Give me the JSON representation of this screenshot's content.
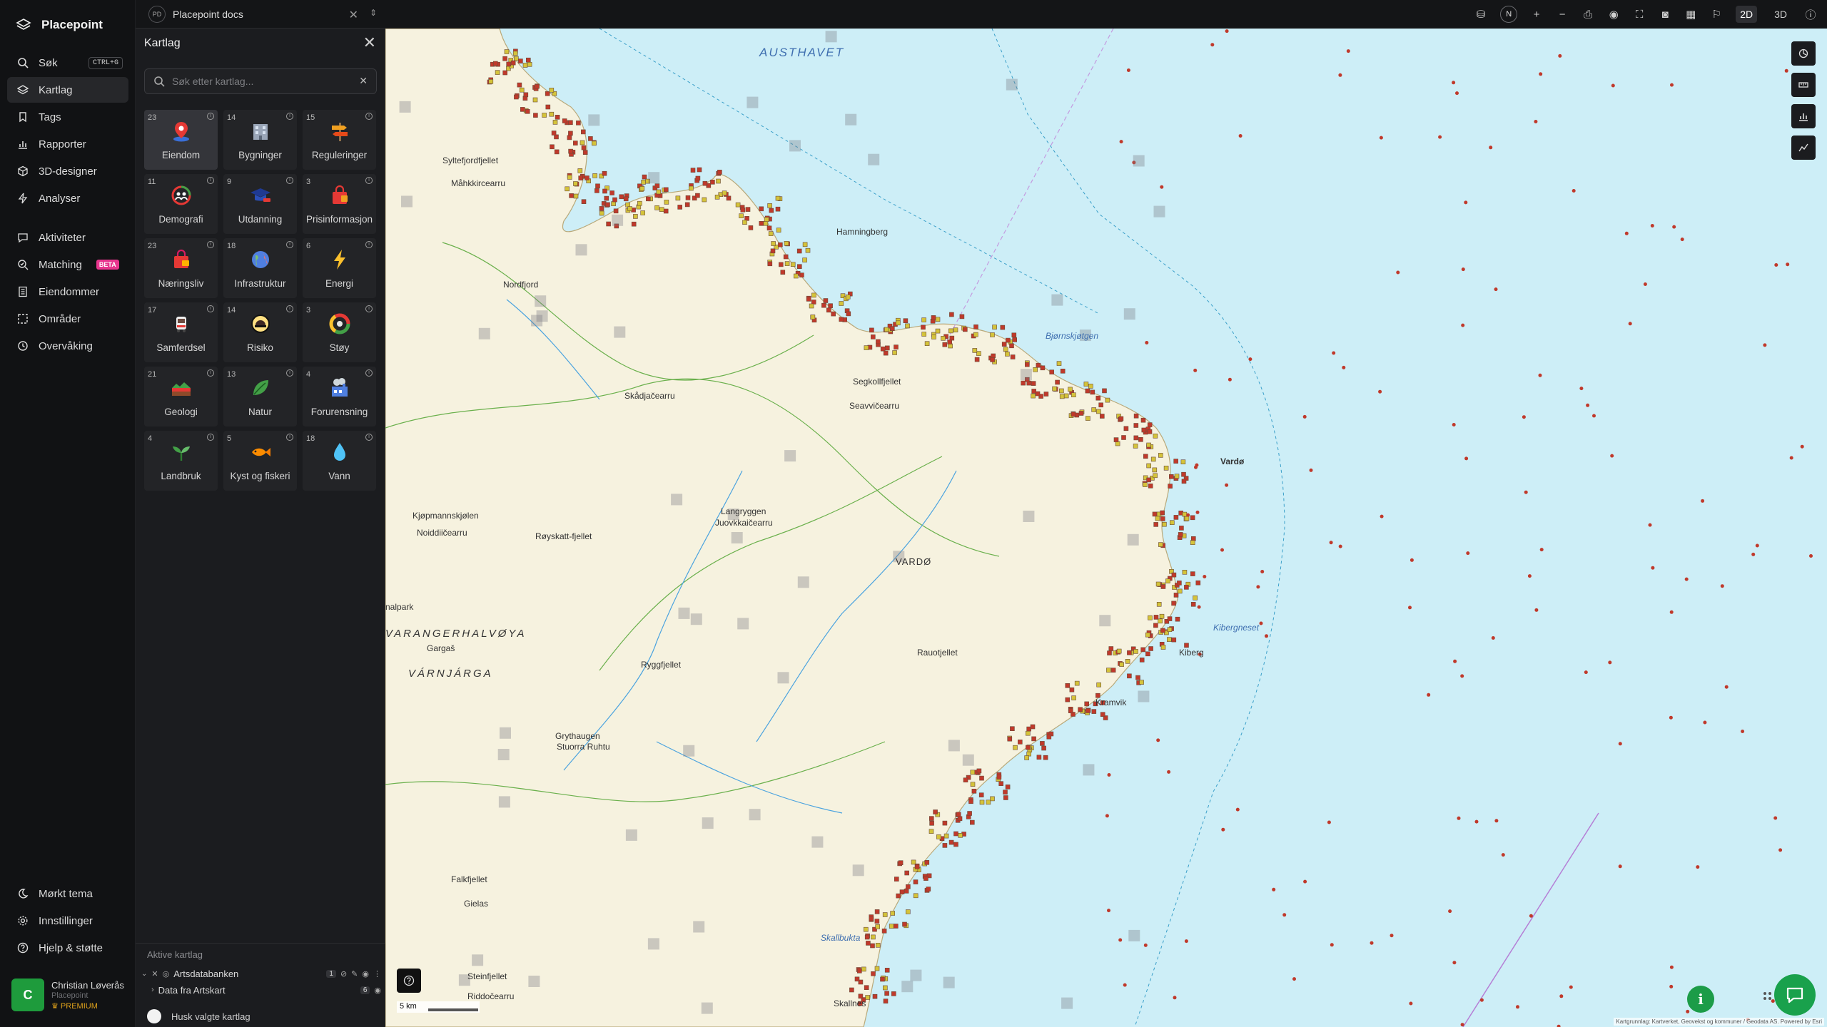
{
  "brand": {
    "name": "Placepoint"
  },
  "nav": {
    "items": [
      {
        "label": "Søk",
        "shortcut": "CTRL+G"
      },
      {
        "label": "Kartlag"
      },
      {
        "label": "Tags"
      },
      {
        "label": "Rapporter"
      },
      {
        "label": "3D-designer"
      },
      {
        "label": "Analyser"
      },
      {
        "label": "Aktiviteter"
      },
      {
        "label": "Matching",
        "badge": "BETA"
      },
      {
        "label": "Eiendommer"
      },
      {
        "label": "Områder"
      },
      {
        "label": "Overvåking"
      }
    ],
    "bottom": [
      {
        "label": "Mørkt tema"
      },
      {
        "label": "Innstillinger"
      },
      {
        "label": "Hjelp & støtte"
      }
    ],
    "user": {
      "initial": "C",
      "name": "Christian Løverås",
      "org": "Placepoint",
      "plan": "PREMIUM"
    }
  },
  "workspace": {
    "badge": "PD",
    "name": "Placepoint docs"
  },
  "panel": {
    "title": "Kartlag",
    "search_placeholder": "Søk etter kartlag...",
    "categories": [
      {
        "count": "23",
        "label": "Eiendom"
      },
      {
        "count": "14",
        "label": "Bygninger"
      },
      {
        "count": "15",
        "label": "Reguleringer"
      },
      {
        "count": "11",
        "label": "Demografi"
      },
      {
        "count": "9",
        "label": "Utdanning"
      },
      {
        "count": "3",
        "label": "Prisinformasjon"
      },
      {
        "count": "23",
        "label": "Næringsliv"
      },
      {
        "count": "18",
        "label": "Infrastruktur"
      },
      {
        "count": "6",
        "label": "Energi"
      },
      {
        "count": "17",
        "label": "Samferdsel"
      },
      {
        "count": "14",
        "label": "Risiko"
      },
      {
        "count": "3",
        "label": "Støy"
      },
      {
        "count": "21",
        "label": "Geologi"
      },
      {
        "count": "13",
        "label": "Natur"
      },
      {
        "count": "4",
        "label": "Forurensning"
      },
      {
        "count": "4",
        "label": "Landbruk"
      },
      {
        "count": "5",
        "label": "Kyst og fiskeri"
      },
      {
        "count": "18",
        "label": "Vann"
      }
    ],
    "active_title": "Aktive kartlag",
    "active_layers": [
      {
        "name": "Artsdatabanken",
        "count": "1"
      },
      {
        "name": "Data fra Artskart",
        "count": "6"
      }
    ],
    "remember_label": "Husk valgte kartlag"
  },
  "topbar": {
    "compass": "N",
    "mode_2d": "2D",
    "mode_3d": "3D"
  },
  "map": {
    "scale_label": "5 km",
    "attribution": "Kartgrunnlag: Kartverket, Geovekst og kommuner / Geodata AS. Powered by Esri",
    "labels": [
      "AUSTHAVET",
      "Syltefjordfjellet",
      "Måhkkircearru",
      "Nordfjord",
      "Skådjačearru",
      "Segkollfjellet",
      "Seavvičearru",
      "Langryggen",
      "Juovkkaičearru",
      "Kjøpmannskjølen",
      "Noiddiičearru",
      "Røyskatt-fjellet",
      "VARDØ",
      "Vardø",
      "Kibergneset",
      "Kiberg",
      "Kramvik",
      "Rauotjellet",
      "Ryggfjellet",
      "Gargaš",
      "VARANGERHALVØYA",
      "VÁRNJÁRGA",
      "Grythaugen",
      "Stuorra Ruhtu",
      "Falkfjellet",
      "Gielas",
      "Steinfjellet",
      "Riddočearru",
      "Skallbukta",
      "Skallnes",
      "Hamningberg",
      "Bjørnskjøtgen",
      "nalpark"
    ],
    "colors": {
      "sea": "#cdeef7",
      "land": "#f6f2df",
      "points": "#c0392b"
    }
  }
}
